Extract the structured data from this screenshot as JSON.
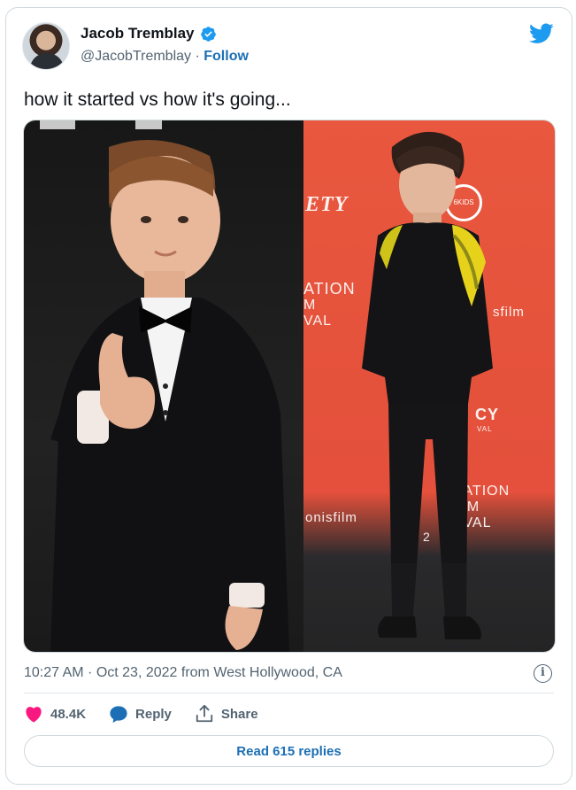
{
  "header": {
    "display_name": "Jacob Tremblay",
    "handle": "@JacobTremblay",
    "separator": " · ",
    "follow_label": "Follow"
  },
  "tweet": {
    "text": "how it started vs how it's going...",
    "timestamp": "10:27 AM · Oct 23, 2022 from West Hollywood, CA"
  },
  "media": {
    "backdrop_signage": {
      "variety": "ETY",
      "kids": "6KIDS",
      "animation_top": "ATION",
      "animation_mid": "M",
      "animation_val": "VAL",
      "film": "sfilm",
      "cy": "CY",
      "cy_sub": "VAL",
      "animation_bottom": "IATION",
      "lm": "LM",
      "ival": "IVAL",
      "two": "2",
      "onisfilm": "onisfilm"
    }
  },
  "actions": {
    "likes": "48.4K",
    "reply_label": "Reply",
    "share_label": "Share"
  },
  "footer": {
    "read_replies_label": "Read 615 replies"
  },
  "icons": {
    "verified": "verified-badge-icon",
    "twitter": "twitter-bird-icon",
    "heart": "heart-icon",
    "reply": "speech-bubble-icon",
    "share": "share-upload-icon",
    "info": "info-icon"
  },
  "colors": {
    "brand_blue": "#1d9bf0",
    "link_blue": "#1d6fb5",
    "heart_pink": "#f91880",
    "muted_text": "#536471"
  }
}
